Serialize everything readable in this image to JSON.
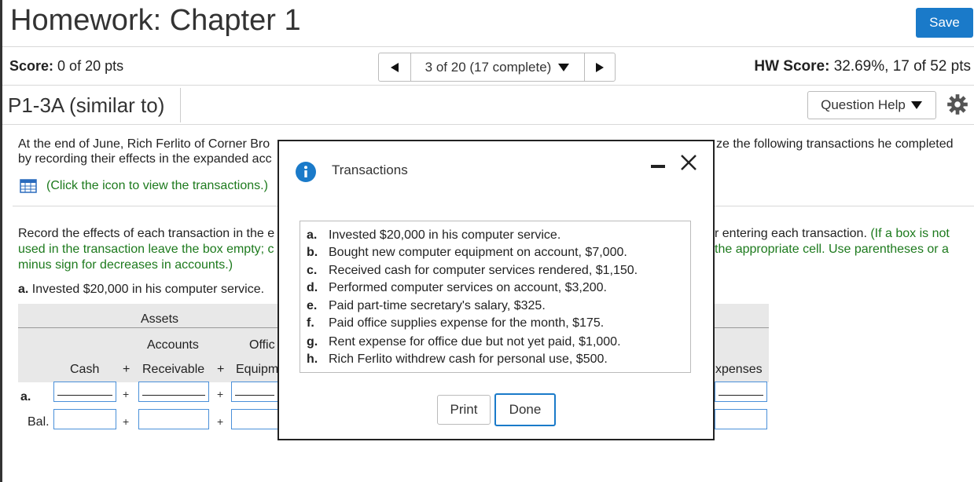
{
  "header": {
    "title": "Homework: Chapter 1",
    "save_label": "Save"
  },
  "score_bar": {
    "score_label": "Score:",
    "score_value": "0 of 20 pts",
    "nav_text": "3 of 20 (17 complete)",
    "hw_score_label": "HW Score:",
    "hw_score_value": "32.69%, 17 of 52 pts"
  },
  "question": {
    "id": "P1-3A (similar to)",
    "help_label": "Question Help"
  },
  "body": {
    "intro_1": "At the end of June, Rich Ferlito of Corner Bro",
    "intro_1_right": "ze the following transactions he completed",
    "intro_2": "by recording their effects in the expanded acc",
    "click_text": "(Click the icon to view the transactions.)",
    "record_1": "Record the effects of each transaction in the e",
    "record_1_right": "r entering each transaction.",
    "record_1_green": "(If a box is not",
    "record_2": "used in the transaction leave the box empty; c",
    "record_2_right": "the appropriate cell. Use parentheses or a",
    "record_3": "minus sign for decreases in accounts.)",
    "task_letter": "a.",
    "task_text": "Invested $20,000 in his computer service."
  },
  "table": {
    "group_header": "Assets",
    "col_accounts": "Accounts",
    "col_office": "Offic",
    "col_cash": "Cash",
    "col_receivable": "Receivable",
    "col_equip": "Equipm",
    "col_expenses": "xpenses",
    "plus": "+",
    "row_a": "a.",
    "row_bal": "Bal."
  },
  "modal": {
    "title": "Transactions",
    "items": [
      {
        "letter": "a.",
        "text": "Invested $20,000 in his computer service."
      },
      {
        "letter": "b.",
        "text": "Bought new computer equipment on account, $7,000."
      },
      {
        "letter": "c.",
        "text": "Received cash for computer services rendered, $1,150."
      },
      {
        "letter": "d.",
        "text": "Performed computer services on account, $3,200."
      },
      {
        "letter": "e.",
        "text": "Paid part-time secretary's salary, $325."
      },
      {
        "letter": "f.",
        "text": "Paid office supplies expense for the month, $175."
      },
      {
        "letter": "g.",
        "text": "Rent expense for office due but not yet paid, $1,000."
      },
      {
        "letter": "h.",
        "text": "Rich Ferlito withdrew cash for personal use, $500."
      }
    ],
    "print_label": "Print",
    "done_label": "Done",
    "minimize_glyph": "–",
    "close_glyph": "✕"
  },
  "colors": {
    "accent": "#1a7ac9",
    "green_text": "#1d7a1d",
    "input_border": "#4a90d9"
  }
}
